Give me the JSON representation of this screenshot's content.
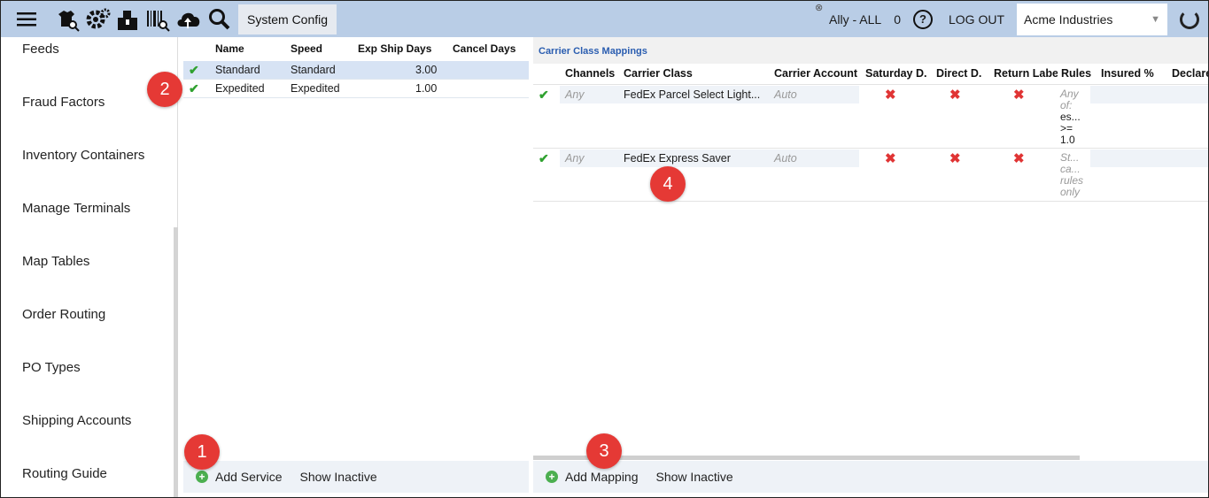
{
  "topbar": {
    "title": "System Config",
    "ally": "Ally - ALL",
    "count": "0",
    "help": "?",
    "logout": "LOG OUT",
    "company": "Acme Industries",
    "icons": [
      "menu-icon",
      "product-search-icon",
      "settings-gears-icon",
      "shipping-box-icon",
      "barcode-search-icon",
      "cloud-upload-icon",
      "search-icon",
      "refresh-icon"
    ]
  },
  "sidebar": {
    "items": [
      {
        "label": "Feeds"
      },
      {
        "label": "Fraud Factors"
      },
      {
        "label": "Inventory Containers"
      },
      {
        "label": "Manage Terminals"
      },
      {
        "label": "Map Tables"
      },
      {
        "label": "Order Routing"
      },
      {
        "label": "PO Types"
      },
      {
        "label": "Shipping Accounts"
      },
      {
        "label": "Routing Guide"
      }
    ]
  },
  "services": {
    "columns": [
      "Name",
      "Speed",
      "Exp Ship Days",
      "Cancel Days"
    ],
    "rows": [
      {
        "name": "Standard",
        "speed": "Standard",
        "exp_ship_days": "3.00",
        "cancel_days": ""
      },
      {
        "name": "Expedited",
        "speed": "Expedited",
        "exp_ship_days": "1.00",
        "cancel_days": ""
      }
    ],
    "add_label": "Add Service",
    "inactive_label": "Show Inactive"
  },
  "mappings": {
    "title": "Carrier Class Mappings",
    "columns": [
      "Channels",
      "Carrier Class",
      "Carrier Account",
      "Saturday D.",
      "Direct D.",
      "Return Labe",
      "Rules",
      "Insured %",
      "Declare"
    ],
    "rows": [
      {
        "channels": "Any",
        "carrier_class": "FedEx Parcel Select Light...",
        "carrier_account": "Auto",
        "rules": [
          "Any",
          "of:",
          "es...",
          ">=",
          "1.0"
        ]
      },
      {
        "channels": "Any",
        "carrier_class": "FedEx Express Saver",
        "carrier_account": "Auto",
        "rules": [
          "St...",
          "ca...",
          "rules",
          "only"
        ]
      }
    ],
    "add_label": "Add Mapping",
    "inactive_label": "Show Inactive"
  },
  "badges": {
    "b1": "1",
    "b2": "2",
    "b3": "3",
    "b4": "4"
  },
  "colors": {
    "topbar": "#b9cde6",
    "badge": "#e53935",
    "check": "#2fa12f",
    "x": "#e03434",
    "title_link": "#2a5db0"
  }
}
